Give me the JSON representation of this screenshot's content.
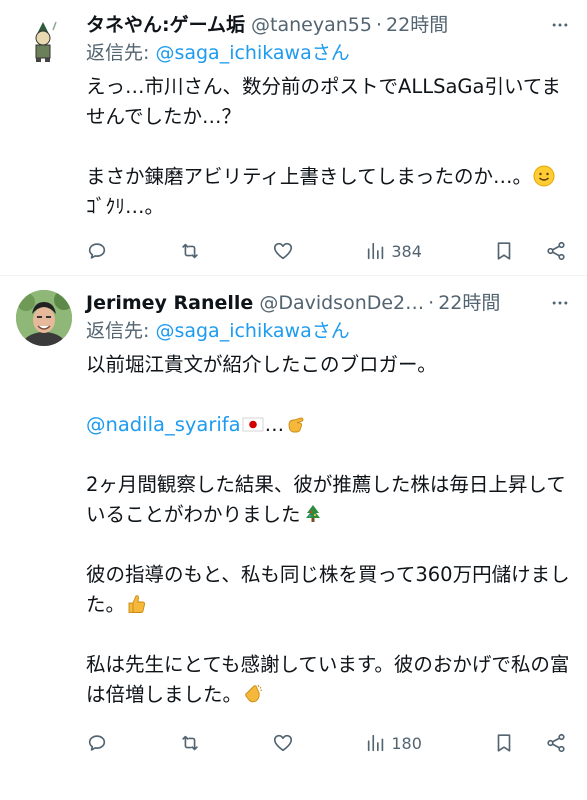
{
  "tweets": [
    {
      "name": "タネやん:ゲーム垢",
      "handle": "@taneyan55",
      "dot": "·",
      "time": "22時間",
      "reply_label": "返信先: ",
      "reply_to": "@saga_ichikawaさん",
      "lines": [
        "えっ…市川さん、数分前のポストでALLSaGa引いてませんでしたか…？",
        "",
        "まさか錬磨アビリティ上書きしてしまったのか…。"
      ],
      "tail_text": "ｺﾞｸﾘ…。",
      "views": "384"
    },
    {
      "name": "Jerimey Ranelle",
      "handle": "@DavidsonDe2…",
      "dot": "·",
      "time": "22時間",
      "reply_label": "返信先: ",
      "reply_to": "@saga_ichikawaさん",
      "line1": "以前堀江貴文が紹介したこのブロガー。",
      "mention": "@nadila_syarifa",
      "mention_tail": "…",
      "line3": "2ヶ月間観察した結果、彼が推薦した株は毎日上昇していることがわかりました",
      "line4": "彼の指導のもと、私も同じ株を買って360万円儲けました。",
      "line5": "私は先生にとても感謝しています。彼のおかげで私の富は倍増しました。",
      "views": "180"
    }
  ],
  "icons": [
    "avatar-image",
    "more-icon",
    "reply-icon",
    "retweet-icon",
    "like-icon",
    "views-icon",
    "bookmark-icon",
    "share-icon",
    "smile-emoji",
    "japan-flag-emoji",
    "pointing-hand-emoji",
    "christmas-tree-emoji",
    "thumbs-up-emoji",
    "clapping-hands-emoji"
  ],
  "colors": {
    "link": "#1d9bf0",
    "secondary": "#536471",
    "text": "#0f1419"
  }
}
